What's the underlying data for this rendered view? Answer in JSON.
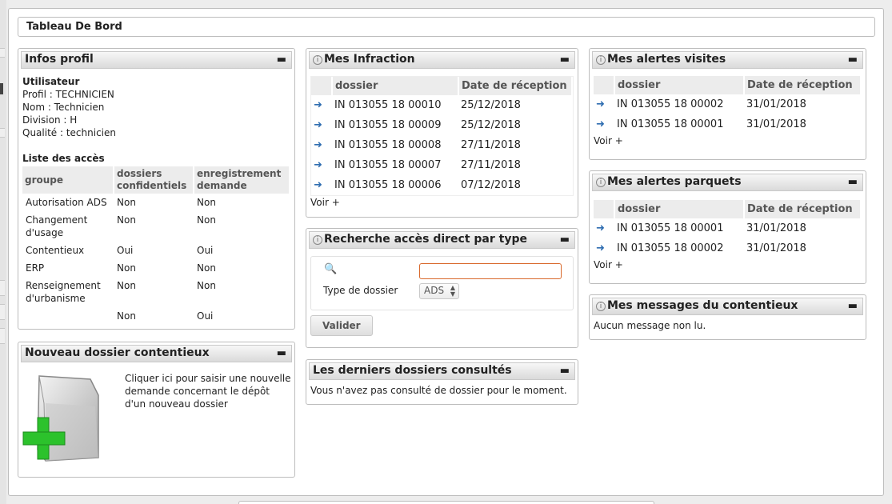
{
  "page_title": "Tableau De Bord",
  "infos_profil": {
    "title": "Infos profil",
    "user_heading": "Utilisateur",
    "lines": [
      "Profil : TECHNICIEN",
      "Nom : Technicien",
      "Division : H",
      "Qualité : technicien"
    ],
    "access_heading": "Liste des accès",
    "columns": [
      "groupe",
      "dossiers confidentiels",
      "enregistrement demande"
    ],
    "rows": [
      [
        "Autorisation ADS",
        "Non",
        "Non"
      ],
      [
        "Changement d'usage",
        "Non",
        "Non"
      ],
      [
        "Contentieux",
        "Oui",
        "Oui"
      ],
      [
        "ERP",
        "Non",
        "Non"
      ],
      [
        "Renseignement d'urbanisme",
        "Non",
        "Non"
      ],
      [
        "",
        "Non",
        "Oui"
      ]
    ]
  },
  "nouveau": {
    "title": "Nouveau dossier contentieux",
    "text": "Cliquer ici pour saisir une nouvelle demande concernant le dépôt d'un nouveau dossier"
  },
  "infraction": {
    "title": "Mes Infraction",
    "columns": [
      "dossier",
      "Date de réception"
    ],
    "rows": [
      [
        "IN 013055 18 00010",
        "25/12/2018"
      ],
      [
        "IN 013055 18 00009",
        "25/12/2018"
      ],
      [
        "IN 013055 18 00008",
        "27/11/2018"
      ],
      [
        "IN 013055 18 00007",
        "27/11/2018"
      ],
      [
        "IN 013055 18 00006",
        "07/12/2018"
      ]
    ],
    "more": "Voir +"
  },
  "recherche": {
    "title": "Recherche accès direct par type",
    "search_value": "",
    "type_label": "Type de dossier",
    "type_selected": "ADS",
    "submit": "Valider"
  },
  "derniers": {
    "title": "Les derniers dossiers consultés",
    "text": "Vous n'avez pas consulté de dossier pour le moment."
  },
  "visites": {
    "title": "Mes alertes visites",
    "columns": [
      "dossier",
      "Date de réception"
    ],
    "rows": [
      [
        "IN 013055 18 00002",
        "31/01/2018"
      ],
      [
        "IN 013055 18 00001",
        "31/01/2018"
      ]
    ],
    "more": "Voir +"
  },
  "parquets": {
    "title": "Mes alertes parquets",
    "columns": [
      "dossier",
      "Date de réception"
    ],
    "rows": [
      [
        "IN 013055 18 00001",
        "31/01/2018"
      ],
      [
        "IN 013055 18 00002",
        "31/01/2018"
      ]
    ],
    "more": "Voir +"
  },
  "messages": {
    "title": "Mes messages du contentieux",
    "text": "Aucun message non lu."
  },
  "icons": {
    "minimize": "minimize-icon",
    "info": "info-icon",
    "row_arrow": "arrow-right-icon",
    "search": "magnifier-icon",
    "new_folder": "folder-add-icon"
  }
}
